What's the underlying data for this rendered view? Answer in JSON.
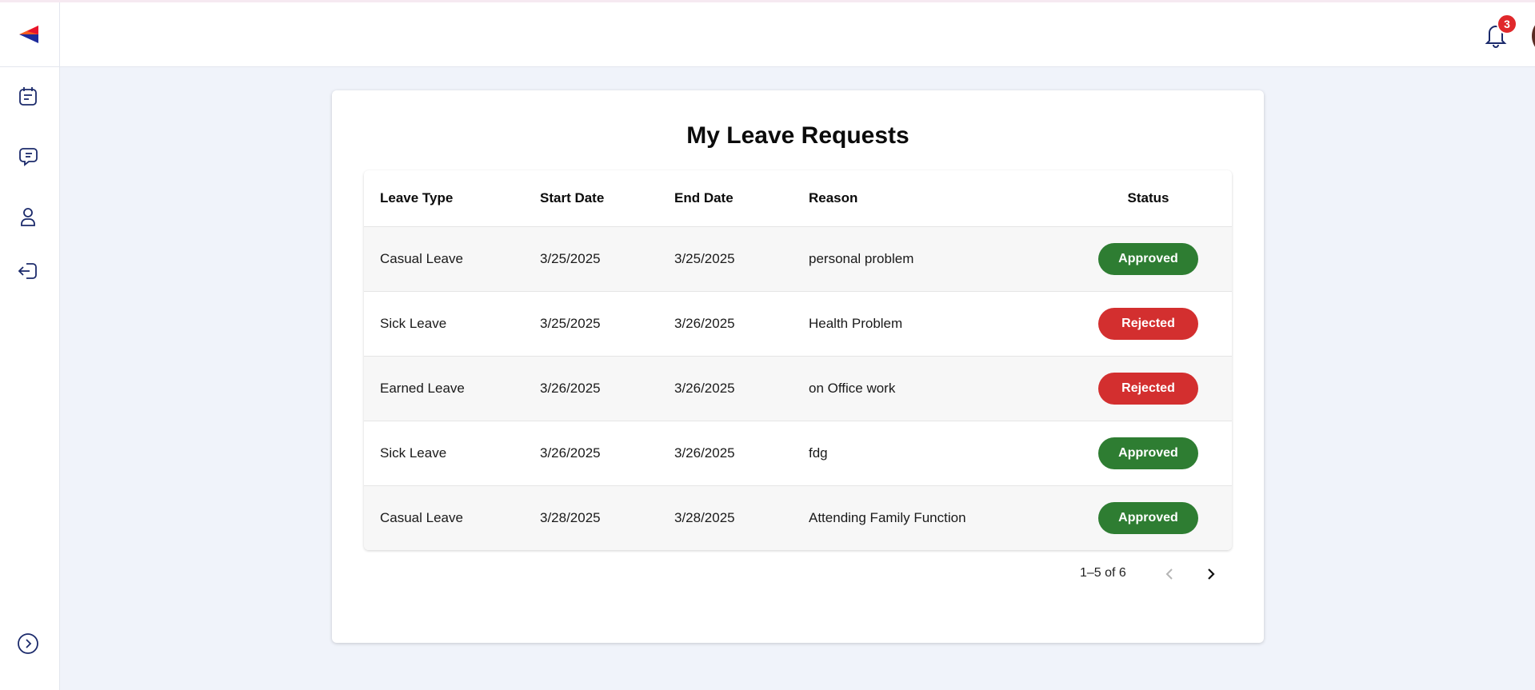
{
  "app": {
    "notification_count": "3"
  },
  "sidebar": {
    "items": [
      {
        "icon": "calendar-icon"
      },
      {
        "icon": "chat-icon"
      },
      {
        "icon": "user-icon"
      },
      {
        "icon": "logout-icon"
      }
    ],
    "expand_icon": "chevron-right-circle-icon"
  },
  "card": {
    "title": "My Leave Requests"
  },
  "table": {
    "headers": [
      "Leave Type",
      "Start Date",
      "End Date",
      "Reason",
      "Status"
    ],
    "rows": [
      {
        "type": "Casual Leave",
        "start": "3/25/2025",
        "end": "3/25/2025",
        "reason": "personal problem",
        "status": "Approved"
      },
      {
        "type": "Sick Leave",
        "start": "3/25/2025",
        "end": "3/26/2025",
        "reason": "Health Problem",
        "status": "Rejected"
      },
      {
        "type": "Earned Leave",
        "start": "3/26/2025",
        "end": "3/26/2025",
        "reason": "on Office work",
        "status": "Rejected"
      },
      {
        "type": "Sick Leave",
        "start": "3/26/2025",
        "end": "3/26/2025",
        "reason": "fdg",
        "status": "Approved"
      },
      {
        "type": "Casual Leave",
        "start": "3/28/2025",
        "end": "3/28/2025",
        "reason": "Attending Family Function",
        "status": "Approved"
      }
    ]
  },
  "pagination": {
    "range_text": "1–5 of 6"
  },
  "colors": {
    "approved": "#2e7d32",
    "rejected": "#d32f2f",
    "badge": "#e0282b",
    "nav_icon": "#1b2a6b"
  }
}
